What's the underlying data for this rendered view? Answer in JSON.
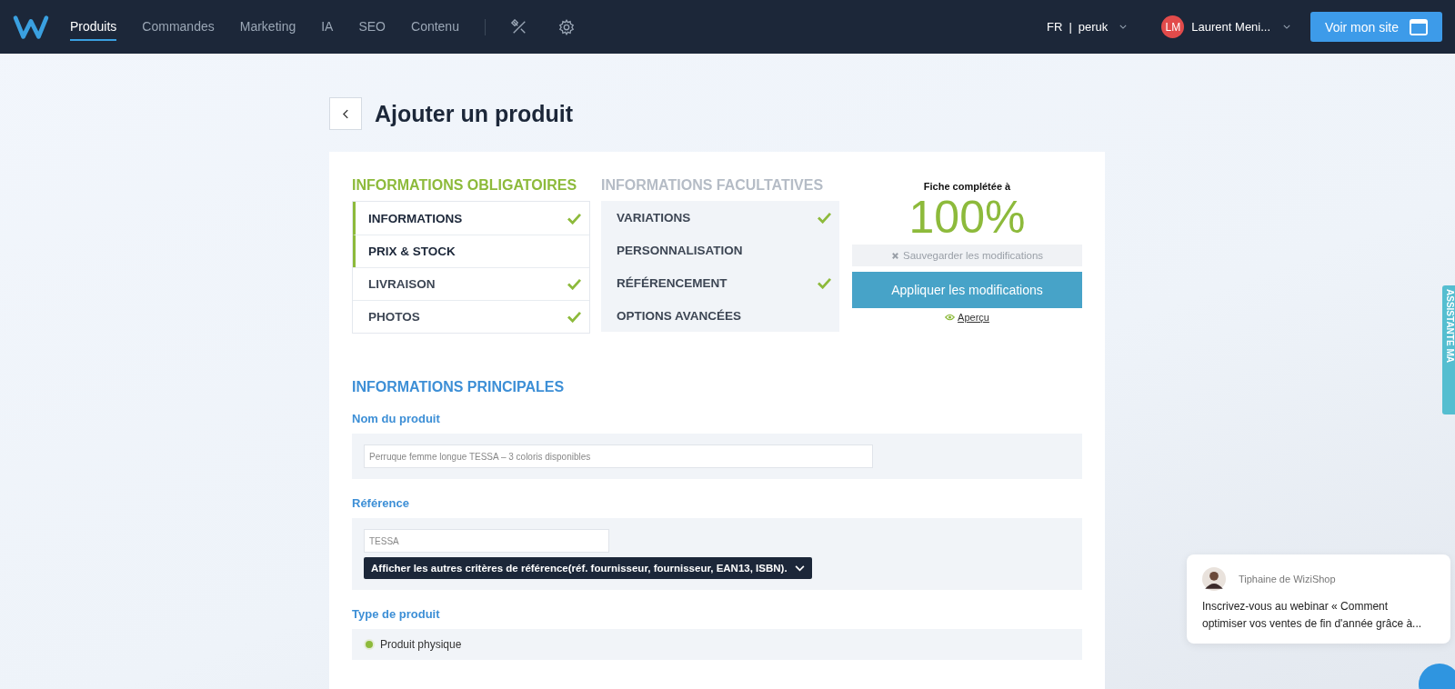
{
  "nav": {
    "items": [
      {
        "label": "Produits",
        "selected": true
      },
      {
        "label": "Commandes",
        "selected": false
      },
      {
        "label": "Marketing",
        "selected": false
      },
      {
        "label": "IA",
        "selected": false
      },
      {
        "label": "SEO",
        "selected": false
      },
      {
        "label": "Contenu",
        "selected": false
      }
    ],
    "lang": "FR",
    "separator": "|",
    "site": "peruk",
    "user_initials": "LM",
    "user_name": "Laurent Meni...",
    "site_button": "Voir mon site"
  },
  "page_title": "Ajouter un produit",
  "required": {
    "title": "INFORMATIONS OBLIGATOIRES",
    "items": [
      {
        "label": "INFORMATIONS",
        "done": true,
        "highlighted": true
      },
      {
        "label": "PRIX & STOCK",
        "done": false,
        "highlighted": true
      },
      {
        "label": "LIVRAISON",
        "done": true,
        "highlighted": false
      },
      {
        "label": "PHOTOS",
        "done": true,
        "highlighted": false
      }
    ]
  },
  "optional": {
    "title": "INFORMATIONS FACULTATIVES",
    "items": [
      {
        "label": "VARIATIONS",
        "done": true
      },
      {
        "label": "PERSONNALISATION",
        "done": false
      },
      {
        "label": "RÉFÉRENCEMENT",
        "done": true
      },
      {
        "label": "OPTIONS AVANCÉES",
        "done": false
      }
    ]
  },
  "completion": {
    "label": "Fiche complétée à",
    "value": "100%",
    "save_button": "Sauvegarder les modifications",
    "save_disabled": true,
    "apply_button": "Appliquer les modifications",
    "preview_link": "Aperçu"
  },
  "form": {
    "title": "INFORMATIONS PRINCIPALES",
    "name_label": "Nom du produit",
    "name_value": "Perruque femme longue TESSA – 3 coloris disponibles",
    "reference_label": "Référence",
    "reference_value": "TESSA",
    "reference_toggle": "Afficher les autres critères de référence(réf. fournisseur, fournisseur, EAN13, ISBN).",
    "type_label": "Type de produit",
    "types": [
      {
        "label": "Produit physique",
        "selected": true
      }
    ]
  },
  "side_tab": "ASSISTANTE MA",
  "chat": {
    "sender": "Tiphaine de WiziShop",
    "message": "Inscrivez-vous au webinar « Comment optimiser vos ventes de fin d'année grâce à..."
  }
}
